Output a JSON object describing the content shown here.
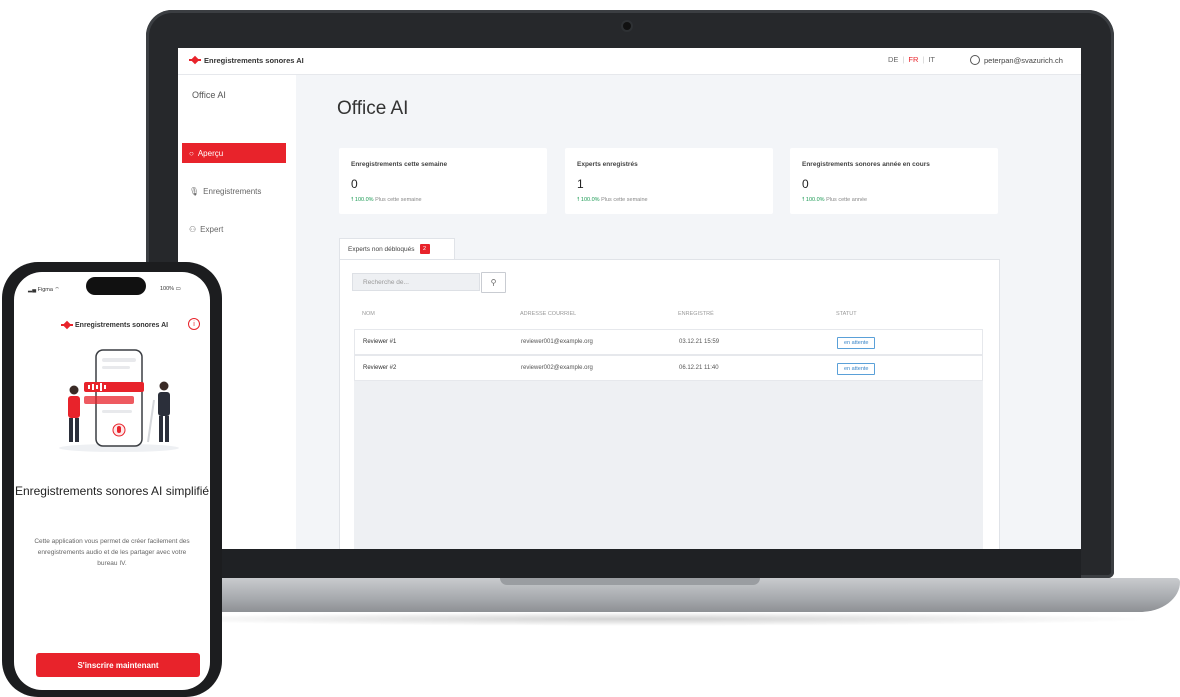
{
  "app": {
    "brand": "Enregistrements sonores AI",
    "languages": [
      "DE",
      "FR",
      "IT"
    ],
    "active_language": "FR",
    "user_email": "peterpan@svazurich.ch"
  },
  "sidebar": {
    "title": "Office AI",
    "items": [
      {
        "label": "Aperçu",
        "icon": "circle-icon",
        "active": true
      },
      {
        "label": "Enregistrements",
        "icon": "microphone-icon",
        "active": false
      },
      {
        "label": "Expert",
        "icon": "users-icon",
        "active": false
      }
    ]
  },
  "main": {
    "title": "Office AI",
    "stats": [
      {
        "label": "Enregistrements cette semaine",
        "value": "0",
        "change": "100.0%",
        "change_note": "Plus cette semaine"
      },
      {
        "label": "Experts enregistrés",
        "value": "1",
        "change": "100.0%",
        "change_note": "Plus cette semaine"
      },
      {
        "label": "Enregistrements sonores année en cours",
        "value": "0",
        "change": "100.0%",
        "change_note": "Plus cette année"
      }
    ],
    "tab": {
      "label": "Experts non débloqués",
      "count": "2"
    },
    "search": {
      "placeholder": "Recherche de..."
    },
    "table": {
      "headers": [
        "NOM",
        "ADRESSE COURRIEL",
        "ENREGISTRÉ",
        "STATUT"
      ],
      "rows": [
        {
          "name": "Reviewer #1",
          "email": "reviewer001@example.org",
          "registered": "03.12.21 15:59",
          "status": "en attente"
        },
        {
          "name": "Reviewer #2",
          "email": "reviewer002@example.org",
          "registered": "06.12.21 11:40",
          "status": "en attente"
        }
      ]
    }
  },
  "phone": {
    "status_left": "Figma",
    "status_right": "100%",
    "brand": "Enregistrements sonores AI",
    "headline": "Enregistrements sonores AI simplifié",
    "description": "Cette application vous permet de créer facilement des enregistrements audio et de les partager avec votre bureau IV.",
    "cta": "S'inscrire maintenant"
  },
  "colors": {
    "accent": "#e8232b",
    "success": "#1a9a53",
    "status_badge": "#3a86c8"
  }
}
